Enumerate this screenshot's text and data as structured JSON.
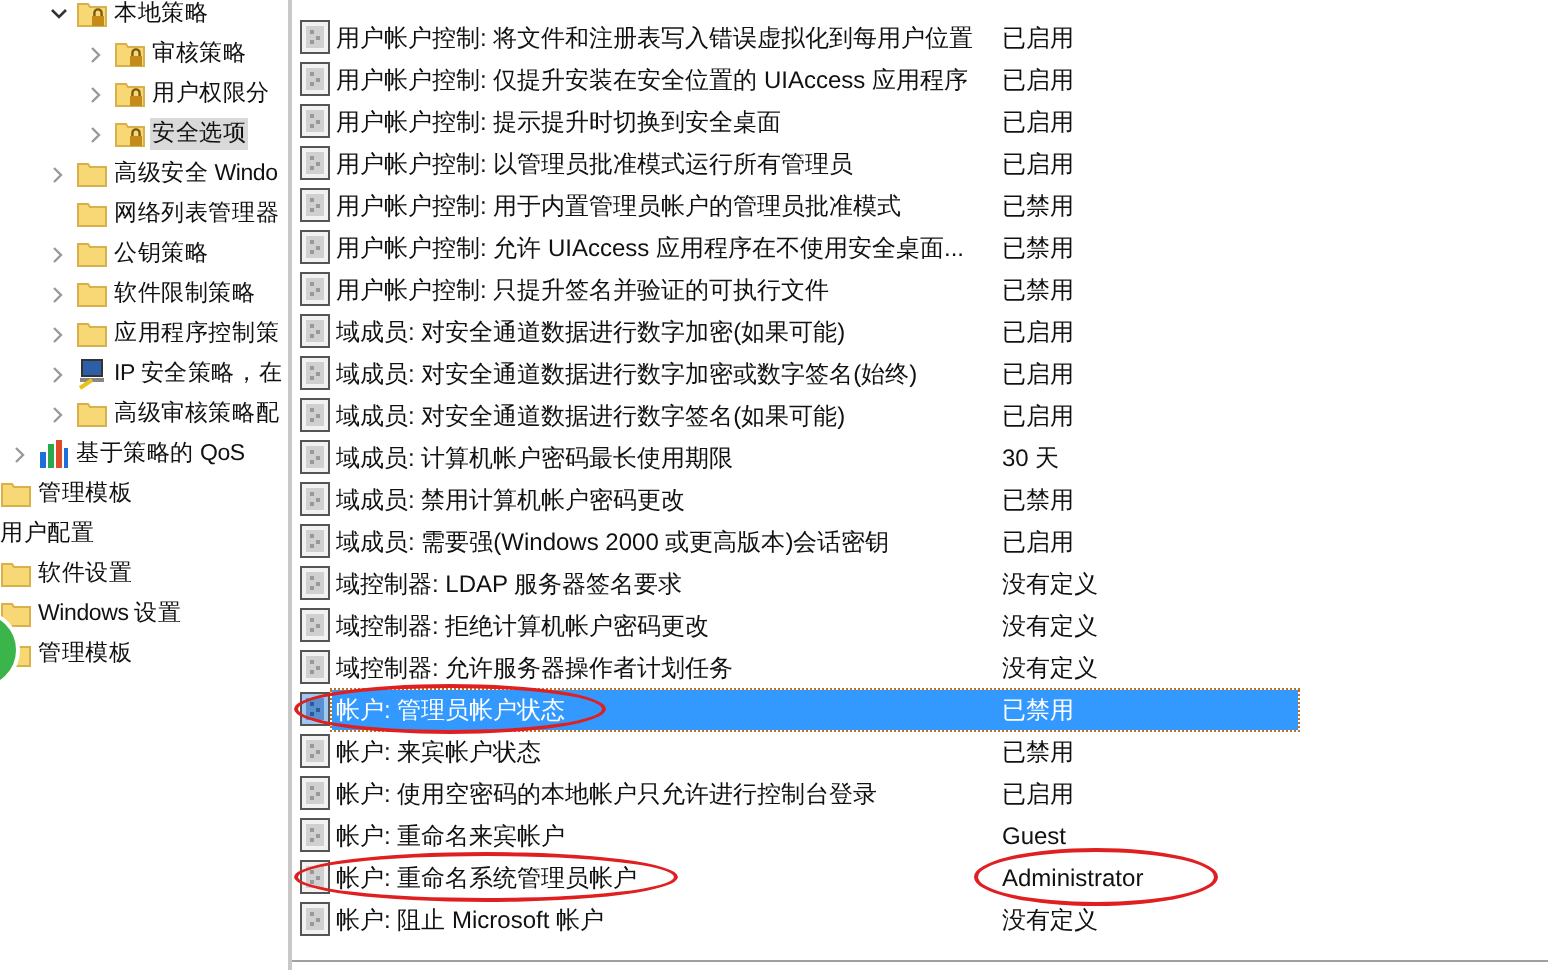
{
  "tree": [
    {
      "children": [
        {
          "children": [
            {
              "children": [
                {
                  "label": "本地策略",
                  "kind": "locked-folder",
                  "expandable": true,
                  "expanded": true,
                  "selected": false,
                  "children": [
                    {
                      "label": "审核策略",
                      "kind": "locked-folder",
                      "expandable": true,
                      "expanded": false,
                      "selected": false
                    },
                    {
                      "label": "用户权限分",
                      "kind": "locked-folder",
                      "expandable": true,
                      "expanded": false,
                      "selected": false
                    },
                    {
                      "label": "安全选项",
                      "kind": "locked-folder",
                      "expandable": true,
                      "expanded": false,
                      "selected": true
                    }
                  ]
                },
                {
                  "label": "高级安全 Windo",
                  "kind": "folder",
                  "expandable": true,
                  "expanded": false,
                  "selected": false
                },
                {
                  "label": "网络列表管理器",
                  "kind": "folder",
                  "selected": false
                },
                {
                  "label": "公钥策略",
                  "kind": "folder",
                  "expandable": true,
                  "expanded": false,
                  "selected": false
                },
                {
                  "label": "软件限制策略",
                  "kind": "folder",
                  "expandable": true,
                  "expanded": false,
                  "selected": false
                },
                {
                  "label": "应用程序控制策",
                  "kind": "folder",
                  "expandable": true,
                  "expanded": false,
                  "selected": false
                },
                {
                  "label": "IP 安全策略，在",
                  "kind": "computer",
                  "expandable": true,
                  "expanded": false,
                  "selected": false
                },
                {
                  "label": "高级审核策略配",
                  "kind": "folder",
                  "expandable": true,
                  "expanded": false,
                  "selected": false
                }
              ]
            },
            {
              "label": "基于策略的 QoS",
              "kind": "bar-chart",
              "expandable": true,
              "expanded": false,
              "selected": false
            }
          ]
        },
        {
          "label": "管理模板",
          "kind": "folder",
          "selected": false
        }
      ]
    },
    {
      "label": "用户配置",
      "selected": false,
      "children": [
        {
          "label": "软件设置",
          "kind": "folder",
          "selected": false
        },
        {
          "label": "Windows 设置",
          "kind": "folder",
          "selected": false
        },
        {
          "label": "管理模板",
          "kind": "folder",
          "selected": false
        }
      ]
    }
  ],
  "policies": [
    {
      "name": "用户帐户控制: 将文件和注册表写入错误虚拟化到每用户位置",
      "setting": "已启用",
      "selected": false,
      "name_circled": false,
      "setting_circled": false
    },
    {
      "name": "用户帐户控制: 仅提升安装在安全位置的 UIAccess 应用程序",
      "setting": "已启用",
      "selected": false,
      "name_circled": false,
      "setting_circled": false
    },
    {
      "name": "用户帐户控制: 提示提升时切换到安全桌面",
      "setting": "已启用",
      "selected": false,
      "name_circled": false,
      "setting_circled": false
    },
    {
      "name": "用户帐户控制: 以管理员批准模式运行所有管理员",
      "setting": "已启用",
      "selected": false,
      "name_circled": false,
      "setting_circled": false
    },
    {
      "name": "用户帐户控制: 用于内置管理员帐户的管理员批准模式",
      "setting": "已禁用",
      "selected": false,
      "name_circled": false,
      "setting_circled": false
    },
    {
      "name": "用户帐户控制: 允许 UIAccess 应用程序在不使用安全桌面...",
      "setting": "已禁用",
      "selected": false,
      "name_circled": false,
      "setting_circled": false
    },
    {
      "name": "用户帐户控制: 只提升签名并验证的可执行文件",
      "setting": "已禁用",
      "selected": false,
      "name_circled": false,
      "setting_circled": false
    },
    {
      "name": "域成员: 对安全通道数据进行数字加密(如果可能)",
      "setting": "已启用",
      "selected": false,
      "name_circled": false,
      "setting_circled": false
    },
    {
      "name": "域成员: 对安全通道数据进行数字加密或数字签名(始终)",
      "setting": "已启用",
      "selected": false,
      "name_circled": false,
      "setting_circled": false
    },
    {
      "name": "域成员: 对安全通道数据进行数字签名(如果可能)",
      "setting": "已启用",
      "selected": false,
      "name_circled": false,
      "setting_circled": false
    },
    {
      "name": "域成员: 计算机帐户密码最长使用期限",
      "setting": "30 天",
      "selected": false,
      "name_circled": false,
      "setting_circled": false
    },
    {
      "name": "域成员: 禁用计算机帐户密码更改",
      "setting": "已禁用",
      "selected": false,
      "name_circled": false,
      "setting_circled": false
    },
    {
      "name": "域成员: 需要强(Windows 2000 或更高版本)会话密钥",
      "setting": "已启用",
      "selected": false,
      "name_circled": false,
      "setting_circled": false
    },
    {
      "name": "域控制器: LDAP 服务器签名要求",
      "setting": "没有定义",
      "selected": false,
      "name_circled": false,
      "setting_circled": false
    },
    {
      "name": "域控制器: 拒绝计算机帐户密码更改",
      "setting": "没有定义",
      "selected": false,
      "name_circled": false,
      "setting_circled": false
    },
    {
      "name": "域控制器: 允许服务器操作者计划任务",
      "setting": "没有定义",
      "selected": false,
      "name_circled": false,
      "setting_circled": false
    },
    {
      "name": "帐户: 管理员帐户状态",
      "setting": "已禁用",
      "selected": true,
      "name_circled": true,
      "setting_circled": false
    },
    {
      "name": "帐户: 来宾帐户状态",
      "setting": "已禁用",
      "selected": false,
      "name_circled": false,
      "setting_circled": false
    },
    {
      "name": "帐户: 使用空密码的本地帐户只允许进行控制台登录",
      "setting": "已启用",
      "selected": false,
      "name_circled": false,
      "setting_circled": false
    },
    {
      "name": "帐户: 重命名来宾帐户",
      "setting": "Guest",
      "selected": false,
      "name_circled": false,
      "setting_circled": false
    },
    {
      "name": "帐户: 重命名系统管理员帐户",
      "setting": "Administrator",
      "selected": false,
      "name_circled": true,
      "setting_circled": true
    },
    {
      "name": "帐户: 阻止 Microsoft 帐户",
      "setting": "没有定义",
      "selected": false,
      "name_circled": false,
      "setting_circled": false
    }
  ]
}
